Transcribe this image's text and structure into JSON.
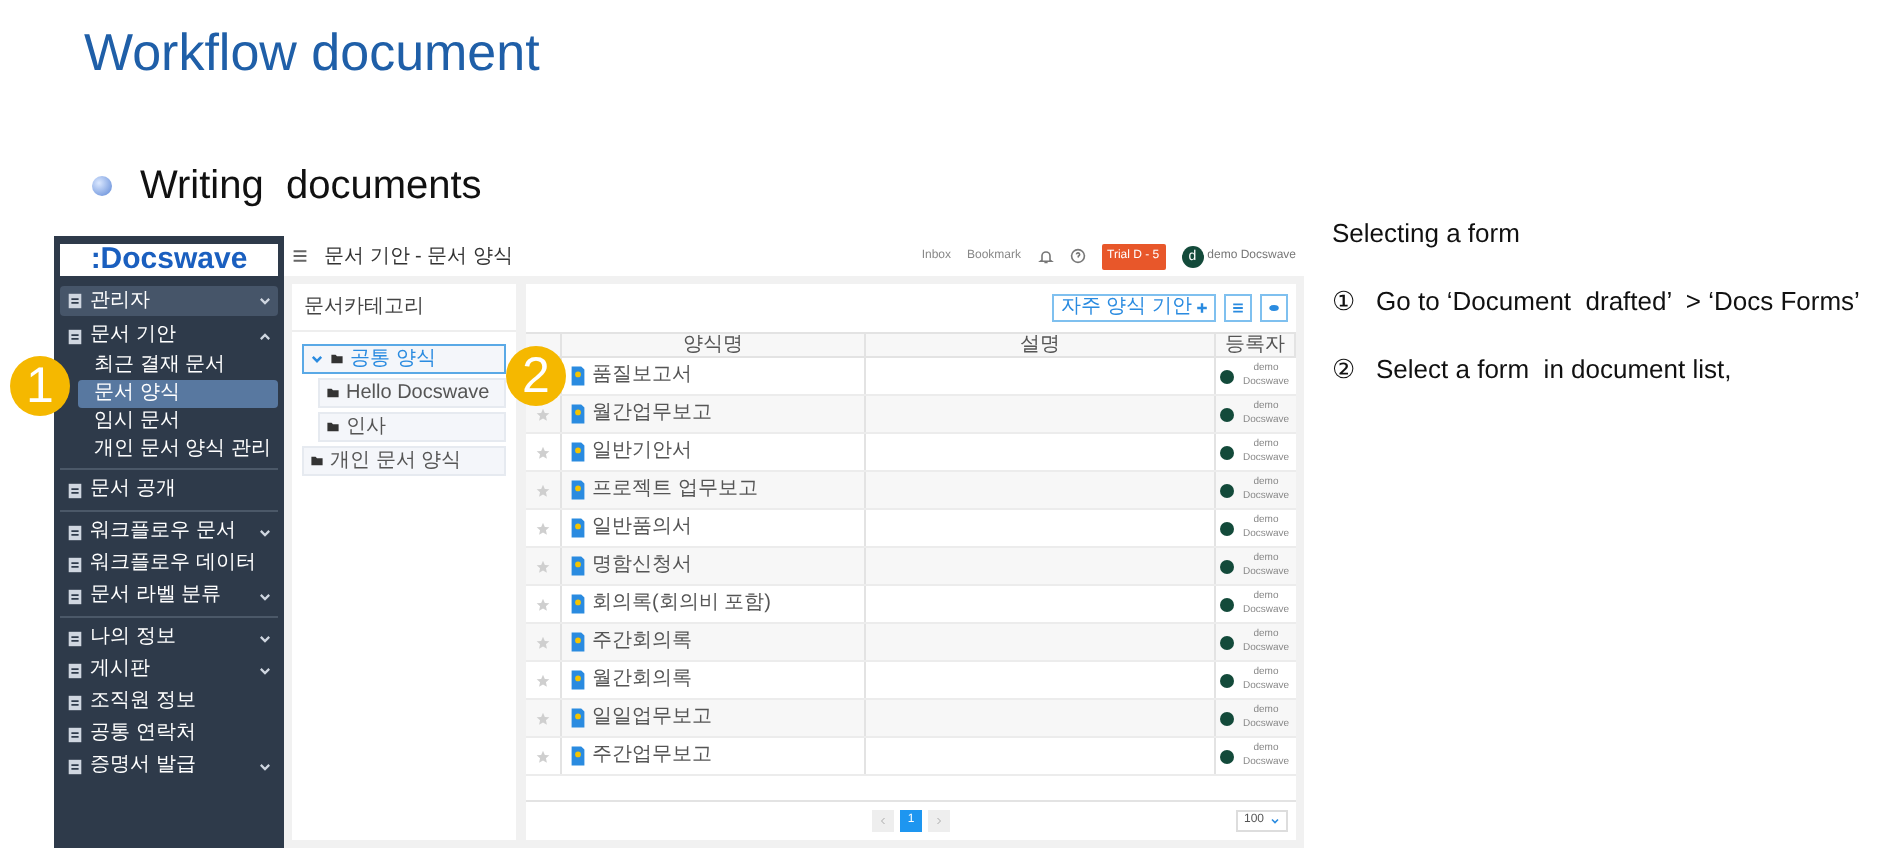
{
  "title": "Workflow document",
  "bullet": "Writing  documents",
  "app": {
    "logo": ":Docswave",
    "sidebar": [
      {
        "label": "관리자",
        "kind": "box",
        "expanded": false
      },
      {
        "label": "문서 기안",
        "kind": "group",
        "expanded": true,
        "children": [
          {
            "label": "최근 결재 문서",
            "selected": false
          },
          {
            "label": "문서 양식",
            "selected": true
          },
          {
            "label": "임시 문서",
            "selected": false
          },
          {
            "label": "개인 문서 양식 관리",
            "selected": false
          }
        ]
      },
      {
        "label": "문서 공개",
        "kind": "item",
        "selected": false
      },
      {
        "label": "워크플로우 문서",
        "kind": "group",
        "expanded": false,
        "selected": false
      },
      {
        "label": "워크플로우 데이터",
        "kind": "item",
        "selected": false
      },
      {
        "label": "문서 라벨 분류",
        "kind": "group",
        "expanded": false,
        "selected": false
      },
      {
        "label": "나의 정보",
        "kind": "group",
        "expanded": false,
        "selected": false
      },
      {
        "label": "게시판",
        "kind": "group",
        "expanded": false,
        "selected": false
      },
      {
        "label": "조직원 정보",
        "kind": "item",
        "selected": false
      },
      {
        "label": "공통 연락처",
        "kind": "item",
        "selected": false
      },
      {
        "label": "증명서 발급",
        "kind": "group",
        "expanded": false,
        "selected": false
      }
    ],
    "breadcrumb": "문서 기안 - 문서 양식",
    "top_links": [
      "Inbox",
      "Bookmark"
    ],
    "trial_badge": "Trial D - 5",
    "user": {
      "initial": "d",
      "name": "demo Docswave"
    },
    "category_panel": {
      "title": "문서카테고리",
      "tree": [
        {
          "label": "공통 양식",
          "selected": true,
          "expanded": true,
          "children": [
            {
              "label": "Hello Docswave",
              "selected": false
            },
            {
              "label": "인사",
              "selected": false
            }
          ]
        },
        {
          "label": "개인 문서 양식",
          "selected": false
        }
      ]
    },
    "favorite_button": "자주 양식 기안",
    "table": {
      "columns": [
        "양식명",
        "설명",
        "등록자"
      ],
      "rows": [
        {
          "name": "품질보고서",
          "registrant": "demo Docswave"
        },
        {
          "name": "월간업무보고",
          "registrant": "demo Docswave"
        },
        {
          "name": "일반기안서",
          "registrant": "demo Docswave"
        },
        {
          "name": "프로젝트 업무보고",
          "registrant": "demo Docswave"
        },
        {
          "name": "일반품의서",
          "registrant": "demo Docswave"
        },
        {
          "name": "명함신청서",
          "registrant": "demo Docswave"
        },
        {
          "name": "회의록(회의비 포함)",
          "registrant": "demo Docswave"
        },
        {
          "name": "주간회의록",
          "registrant": "demo Docswave"
        },
        {
          "name": "월간회의록",
          "registrant": "demo Docswave"
        },
        {
          "name": "일일업무보고",
          "registrant": "demo Docswave"
        },
        {
          "name": "주간업무보고",
          "registrant": "demo Docswave"
        }
      ]
    },
    "pagination": {
      "pages": [
        {
          "label": "1",
          "selected": true
        }
      ],
      "page_size": "100"
    }
  },
  "callouts": [
    "1",
    "2"
  ],
  "side_notes": {
    "heading": "Selecting a form",
    "steps": [
      {
        "marker": "①",
        "text": "Go to ‘Document  drafted’  > ‘Docs Forms’"
      },
      {
        "marker": "②",
        "text": "Select a form  in document list,"
      }
    ]
  }
}
